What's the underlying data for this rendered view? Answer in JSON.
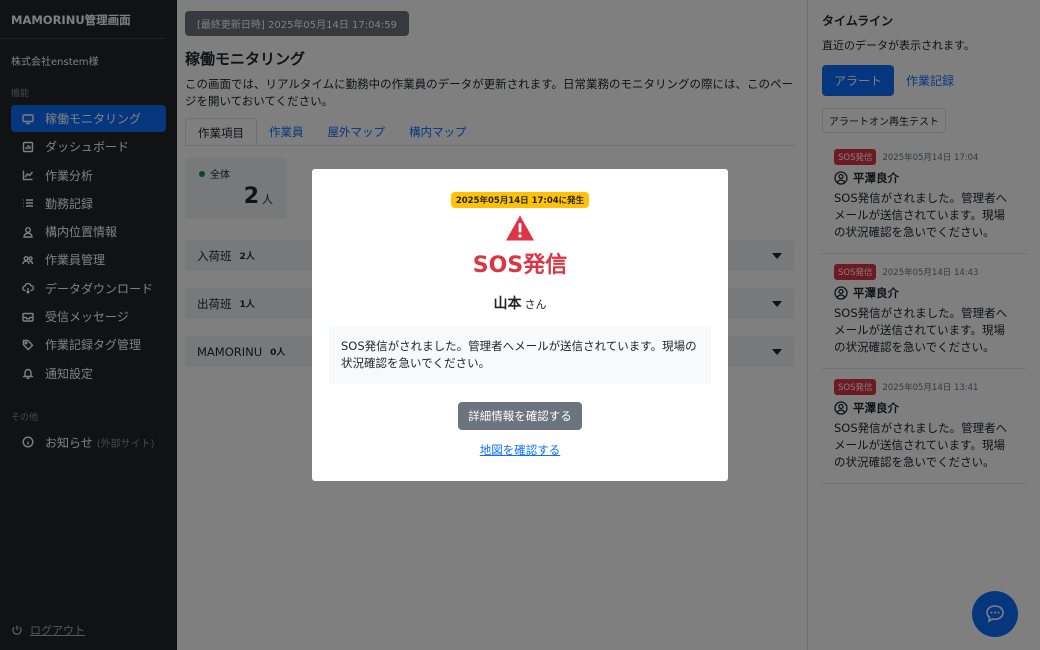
{
  "app": {
    "brand": "MAMORINU管理画面",
    "company": "株式会社enstem様"
  },
  "sidebar": {
    "section_features": "機能",
    "items": [
      {
        "label": "稼働モニタリング",
        "icon": "monitor-icon",
        "active": true
      },
      {
        "label": "ダッシュボード",
        "icon": "dashboard-icon"
      },
      {
        "label": "作業分析",
        "icon": "chart-line-icon"
      },
      {
        "label": "勤務記録",
        "icon": "list-icon"
      },
      {
        "label": "構内位置情報",
        "icon": "person-pin-icon"
      },
      {
        "label": "作業員管理",
        "icon": "people-icon"
      },
      {
        "label": "データダウンロード",
        "icon": "cloud-download-icon"
      },
      {
        "label": "受信メッセージ",
        "icon": "inbox-icon"
      },
      {
        "label": "作業記録タグ管理",
        "icon": "tag-icon"
      },
      {
        "label": "通知設定",
        "icon": "bell-icon"
      }
    ],
    "section_other": "その他",
    "news": {
      "label": "お知らせ",
      "external": "(外部サイト)"
    },
    "logout": "ログアウト"
  },
  "main": {
    "updated": "[最終更新日時] 2025年05月14日 17:04:59",
    "title": "稼働モニタリング",
    "description": "この画面では、リアルタイムに勤務中の作業員のデータが更新されます。日常業務のモニタリングの際には、このページを開いておいてください。",
    "tabs": [
      "作業項目",
      "作業員",
      "屋外マップ",
      "構内マップ"
    ],
    "stat": {
      "label": "全体",
      "value": "2",
      "unit": "人"
    },
    "groups": [
      {
        "name": "入荷班",
        "count": "2人"
      },
      {
        "name": "出荷班",
        "count": "1人"
      },
      {
        "name": "MAMORINU",
        "count": "0人"
      }
    ]
  },
  "timeline": {
    "title": "タイムライン",
    "subtitle": "直近のデータが表示されます。",
    "btn_alert": "アラート",
    "btn_records": "作業記録",
    "test_button": "アラートオン再生テスト",
    "items": [
      {
        "badge": "SOS発信",
        "time": "2025年05月14日 17:04",
        "user": "平澤良介",
        "message": "SOS発信がされました。管理者へメールが送信されています。現場の状況確認を急いでください。"
      },
      {
        "badge": "SOS発信",
        "time": "2025年05月14日 14:43",
        "user": "平澤良介",
        "message": "SOS発信がされました。管理者へメールが送信されています。現場の状況確認を急いでください。"
      },
      {
        "badge": "SOS発信",
        "time": "2025年05月14日 13:41",
        "user": "平澤良介",
        "message": "SOS発信がされました。管理者へメールが送信されています。現場の状況確認を急いでください。"
      }
    ]
  },
  "modal": {
    "occurred": "2025年05月14日 17:04に発生",
    "title": "SOS発信",
    "person": "山本",
    "honorific": "さん",
    "message": "SOS発信がされました。管理者へメールが送信されています。現場の状況確認を急いでください。",
    "detail_button": "詳細情報を確認する",
    "map_link": "地図を確認する"
  },
  "colors": {
    "primary": "#0d6efd",
    "danger": "#dc3545",
    "warning": "#ffc107",
    "sidebar": "#212529"
  }
}
